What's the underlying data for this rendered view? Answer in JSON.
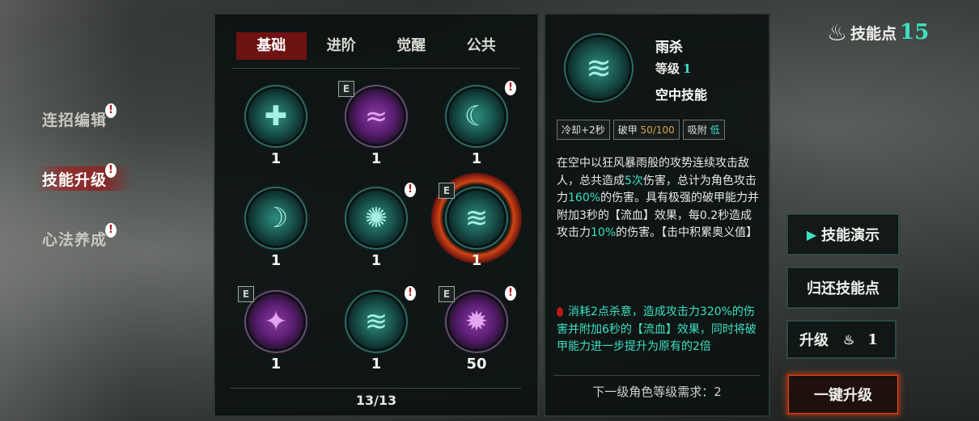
{
  "side_nav": {
    "items": [
      {
        "label": "连招编辑",
        "alert": "!"
      },
      {
        "label": "技能升级",
        "alert": "!"
      },
      {
        "label": "心法养成",
        "alert": "!"
      }
    ]
  },
  "tabs": [
    "基础",
    "进阶",
    "觉醒",
    "公共"
  ],
  "skills": [
    {
      "level": "1",
      "icon": "sword-cross-icon",
      "glyph": "✚",
      "color": "teal",
      "badge": "",
      "alert": ""
    },
    {
      "level": "1",
      "icon": "dragon-strike-icon",
      "glyph": "≈",
      "color": "purple",
      "badge": "E",
      "alert": ""
    },
    {
      "level": "1",
      "icon": "wind-slash-icon",
      "glyph": "☾",
      "color": "teal",
      "badge": "",
      "alert": "!"
    },
    {
      "level": "1",
      "icon": "crescent-slash-icon",
      "glyph": "☽",
      "color": "teal",
      "badge": "",
      "alert": ""
    },
    {
      "level": "1",
      "icon": "spiral-icon",
      "glyph": "✺",
      "color": "teal",
      "badge": "",
      "alert": "!"
    },
    {
      "level": "1",
      "icon": "tornado-icon",
      "glyph": "≋",
      "color": "teal",
      "badge": "E",
      "alert": ""
    },
    {
      "level": "1",
      "icon": "beast-claw-icon",
      "glyph": "✦",
      "color": "purple",
      "badge": "E",
      "alert": ""
    },
    {
      "level": "1",
      "icon": "whirlwind-icon",
      "glyph": "≋",
      "color": "teal",
      "badge": "",
      "alert": "!"
    },
    {
      "level": "50",
      "icon": "shadow-burst-icon",
      "glyph": "✹",
      "color": "purple",
      "badge": "E",
      "alert": "!"
    }
  ],
  "page_count": "13/13",
  "skill_points": {
    "label": "技能点",
    "value": "15"
  },
  "detail": {
    "name": "雨杀",
    "level_label": "等级",
    "level_value": "1",
    "type": "空中技能",
    "tags": {
      "cooldown": "冷却+2秒",
      "armor_label": "破甲",
      "armor_value": "50/100",
      "absorb_label": "吸附",
      "absorb_value": "低"
    },
    "desc": {
      "p1": "在空中以狂风暴雨般的攻势连续攻击敌人，总共造成",
      "hits": "5次",
      "p2": "伤害，总计为角色攻击力",
      "pct1": "160%",
      "p3": "的伤害。具有极强的破甲能力并附加3秒的【流血】效果，每0.2秒造成攻击力",
      "pct2": "10%",
      "p4": "的伤害。【击中积累奥义值】"
    },
    "extra": "消耗2点杀意，造成攻击力320%的伤害并附加6秒的【流血】效果，同时将破甲能力进一步提升为原有的2倍",
    "next_req": "下一级角色等级需求：2"
  },
  "buttons": {
    "demo": "技能演示",
    "refund": "归还技能点",
    "upgrade": "升级",
    "upgrade_cost": "1",
    "one_key": "一键升级"
  }
}
